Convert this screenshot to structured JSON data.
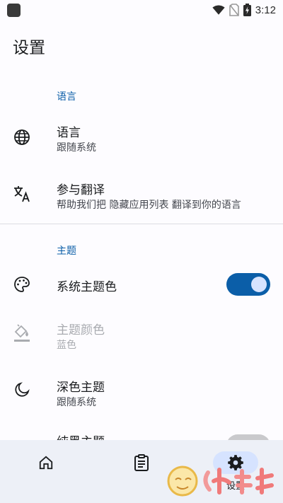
{
  "status_bar": {
    "time": "3:12"
  },
  "page": {
    "title": "设置"
  },
  "sections": {
    "language": {
      "header": "语言",
      "language_item": {
        "title": "语言",
        "subtitle": "跟随系统",
        "icon": "globe-icon"
      },
      "translate_item": {
        "title": "参与翻译",
        "subtitle": "帮助我们把 隐藏应用列表 翻译到你的语言",
        "icon": "translate-icon"
      }
    },
    "theme": {
      "header": "主题",
      "system_color": {
        "title": "系统主题色",
        "icon": "palette-icon",
        "enabled": true
      },
      "theme_color": {
        "title": "主题颜色",
        "subtitle": "蓝色",
        "icon": "paint-bucket-icon",
        "disabled": true
      },
      "dark_theme": {
        "title": "深色主题",
        "subtitle": "跟随系统",
        "icon": "moon-icon"
      },
      "pure_black": {
        "title": "纯黑主题",
        "enabled": false
      }
    }
  },
  "bottom_nav": {
    "items": [
      {
        "icon": "home-icon",
        "label": ""
      },
      {
        "icon": "clipboard-icon",
        "label": ""
      },
      {
        "icon": "gear-icon",
        "label": "设置",
        "active": true
      }
    ]
  },
  "colors": {
    "accent": "#0b5ea8",
    "switch_thumb": "#d6e3ff",
    "nav_bg": "#edf0f7"
  }
}
